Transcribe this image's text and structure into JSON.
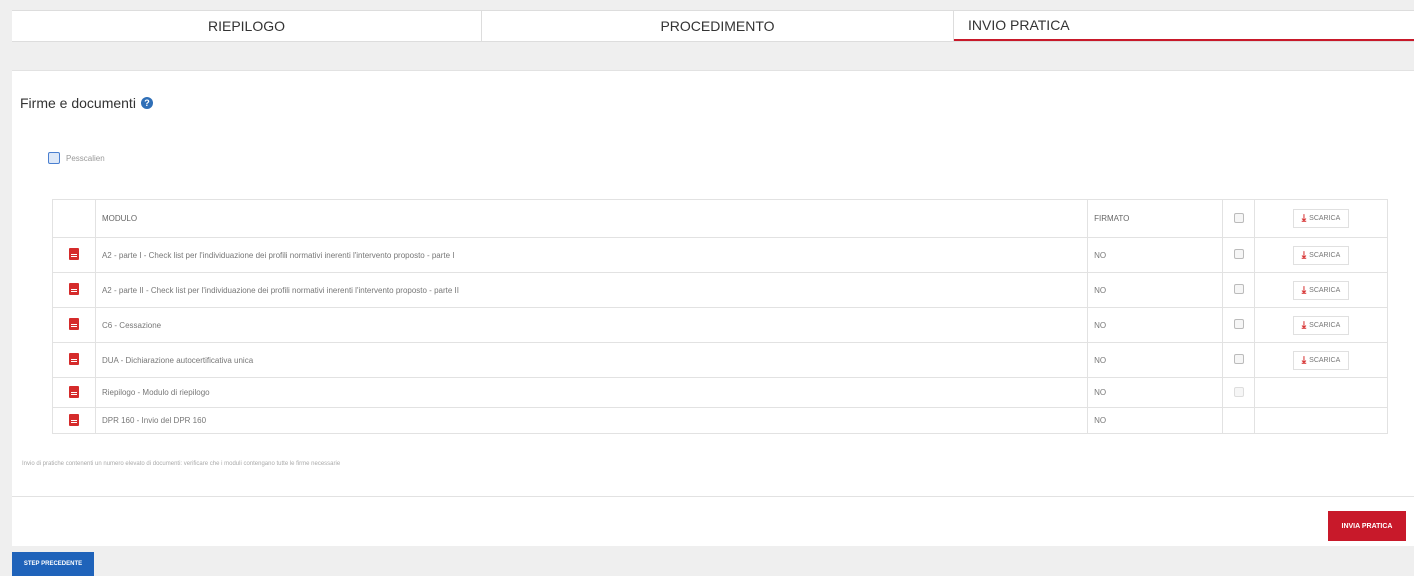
{
  "tabs": [
    {
      "label": "RIEPILOGO"
    },
    {
      "label": "PROCEDIMENTO"
    },
    {
      "label": "INVIO PRATICA"
    }
  ],
  "section": {
    "title": "Firme e documenti",
    "help_icon": "?",
    "select_all_label": "Pesscalien"
  },
  "table": {
    "headers": {
      "modulo": "MODULO",
      "firmato": "FIRMATO",
      "download": "SCARICA"
    },
    "rows": [
      {
        "modulo": "A2 - parte I - Check list per l'individuazione dei profili normativi inerenti l'intervento proposto - parte I",
        "firmato": "NO",
        "scarica": "SCARICA"
      },
      {
        "modulo": "A2 - parte II - Check list per l'individuazione dei profili normativi inerenti l'intervento proposto - parte II",
        "firmato": "NO",
        "scarica": "SCARICA"
      },
      {
        "modulo": "C6 - Cessazione",
        "firmato": "NO",
        "scarica": "SCARICA"
      },
      {
        "modulo": "DUA - Dichiarazione autocertificativa unica",
        "firmato": "NO",
        "scarica": "SCARICA"
      },
      {
        "modulo": "Riepilogo - Modulo di riepilogo",
        "firmato": "NO",
        "scarica": ""
      },
      {
        "modulo": "DPR 160 - Invio del DPR 160",
        "firmato": "NO",
        "scarica": ""
      }
    ]
  },
  "note": "Invio di pratiche contenenti un numero elevato di documenti: verificare che i moduli contengano tutte le firme necessarie",
  "buttons": {
    "submit": "INVIA PRATICA",
    "previous": "STEP PRECEDENTE"
  },
  "colors": {
    "accent_red": "#c8192a",
    "primary_blue": "#1f63ba",
    "pdf_red": "#d52b2b"
  }
}
